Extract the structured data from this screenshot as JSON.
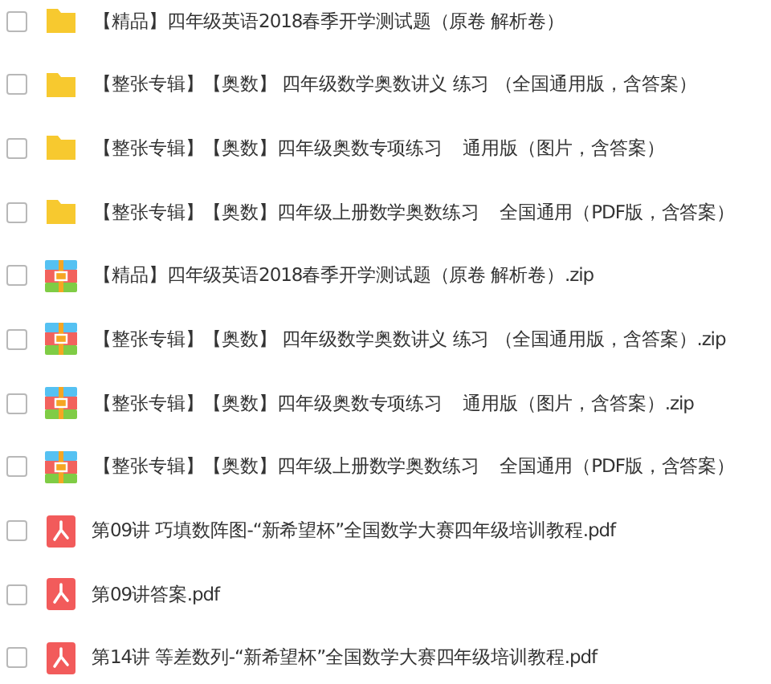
{
  "files": [
    {
      "kind": "folder",
      "name": "【精品】四年级英语2018春季开学测试题（原卷 解析卷）",
      "checked": false
    },
    {
      "kind": "folder",
      "name": "【整张专辑】【奥数】 四年级数学奥数讲义 练习 （全国通用版，含答案）",
      "checked": false
    },
    {
      "kind": "folder",
      "name": "【整张专辑】【奥数】四年级奥数专项练习    通用版（图片，含答案）",
      "checked": false
    },
    {
      "kind": "folder",
      "name": "【整张专辑】【奥数】四年级上册数学奥数练习    全国通用（PDF版，含答案）",
      "checked": false
    },
    {
      "kind": "zip",
      "name": "【精品】四年级英语2018春季开学测试题（原卷 解析卷）.zip",
      "checked": false
    },
    {
      "kind": "zip",
      "name": "【整张专辑】【奥数】 四年级数学奥数讲义 练习 （全国通用版，含答案）.zip",
      "checked": false
    },
    {
      "kind": "zip",
      "name": "【整张专辑】【奥数】四年级奥数专项练习    通用版（图片，含答案）.zip",
      "checked": false
    },
    {
      "kind": "zip",
      "name": "【整张专辑】【奥数】四年级上册数学奥数练习    全国通用（PDF版，含答案）",
      "checked": false
    },
    {
      "kind": "pdf",
      "name": "第09讲 巧填数阵图-“新希望杯”全国数学大赛四年级培训教程.pdf",
      "checked": false
    },
    {
      "kind": "pdf",
      "name": "第09讲答案.pdf",
      "checked": false
    },
    {
      "kind": "pdf",
      "name": "第14讲 等差数列-“新希望杯”全国数学大赛四年级培训教程.pdf",
      "checked": false
    }
  ]
}
